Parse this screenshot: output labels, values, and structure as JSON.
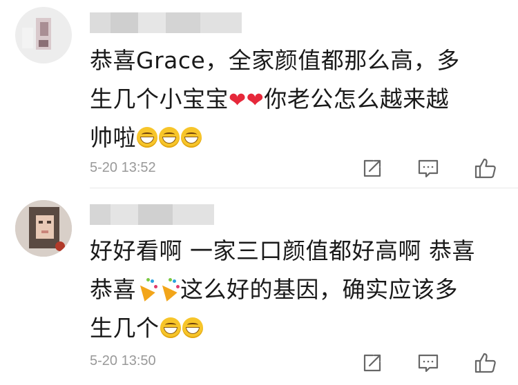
{
  "comments": [
    {
      "line1": "恭喜Grace，全家颜值都那么高，多",
      "line2_a": "生几个小宝宝",
      "line2_b": "你老公怎么越来越",
      "line3": "帅啦",
      "heart": "❤",
      "time": "5-20 13:52"
    },
    {
      "line1": "好好看啊 一家三口颜值都好高啊 恭喜",
      "line2_a": "恭喜",
      "line2_b": "这么好的基因，确实应该多",
      "line3": "生几个",
      "time": "5-20 13:50"
    }
  ],
  "icons": {
    "share": "share-icon",
    "comment": "comment-icon",
    "like": "thumbs-up-icon"
  },
  "colors": {
    "meta": "#999999",
    "heart": "#e6283a",
    "emoji": "#f7c52a"
  }
}
